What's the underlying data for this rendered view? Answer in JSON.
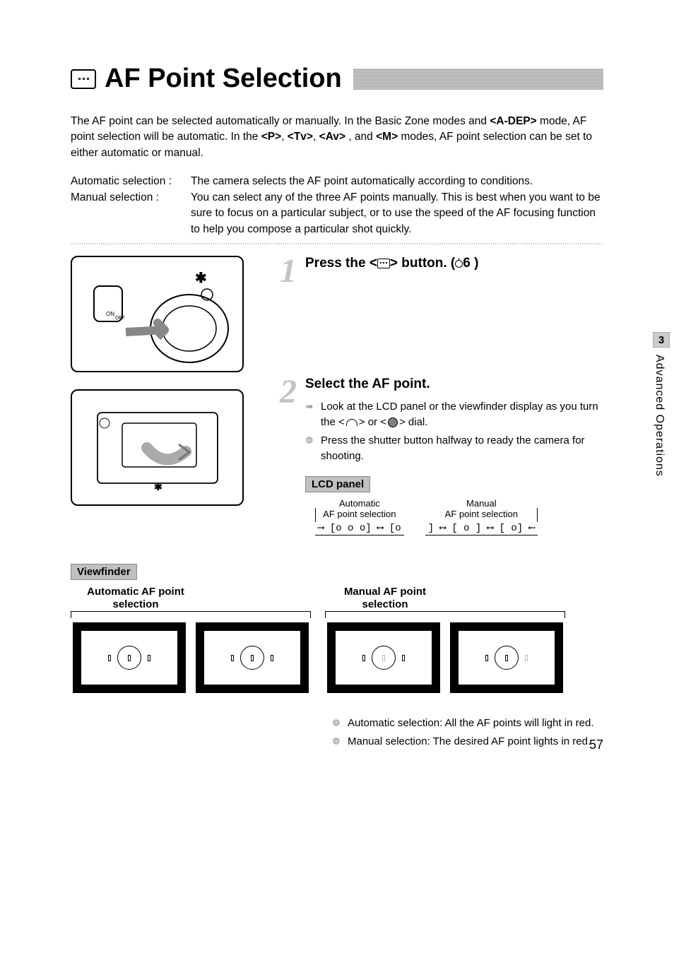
{
  "title": "AF Point Selection",
  "intro_p1_a": "The AF point can be selected automatically or manually. In the Basic Zone modes and ",
  "intro_mode_adep": "A-DEP",
  "intro_p1_b": " mode, AF point selection will be automatic. In the ",
  "intro_mode_p": "P",
  "intro_mode_tv": "Tv",
  "intro_mode_av": "Av",
  "intro_and": ", and ",
  "intro_mode_m": "M",
  "intro_p1_c": " modes, AF point selection can be set to either automatic or manual.",
  "sel_auto_label": "Automatic selection :",
  "sel_manual_label": "Manual selection :",
  "sel_auto_desc": "The camera selects the AF point automatically according to conditions.",
  "sel_manual_desc": "You can select any of the three AF points manually. This is best when you want to be sure to focus on a particular subject, or to use the speed of the AF focusing function to help you compose a particular shot quickly.",
  "step1_head_a": "Press the <",
  "step1_head_b": "> button. (",
  "step1_timer_val": "6",
  "step1_head_c": " )",
  "step2_head": "Select the AF point.",
  "step2_b1_a": "Look at the LCD panel or the viewfinder display as you turn the <",
  "step2_b1_mid": "> or <",
  "step2_b1_b": "> dial.",
  "step2_b2": "Press the shutter button halfway to ready the camera for shooting.",
  "lcd_label": "LCD panel",
  "lcd_auto_head1": "Automatic",
  "lcd_auto_head2": "AF point selection",
  "lcd_manual_head1": "Manual",
  "lcd_manual_head2": "AF point selection",
  "lcd_auto_seq": "⟶ [o  o  o] ⟷ [o",
  "lcd_manual_seq": "] ⟷ [   o   ] ⟷ [      o] ⟵",
  "vf_label": "Viewfinder",
  "vf_auto_head": "Automatic AF point selection",
  "vf_manual_head": "Manual AF point selection",
  "note_auto": "Automatic selection: All the AF points will light in red.",
  "note_manual": "Manual selection: The desired AF point lights in red.",
  "side_chapter_num": "3",
  "side_chapter_title": "Advanced Operations",
  "page_number": "57",
  "sep_comma": ", "
}
